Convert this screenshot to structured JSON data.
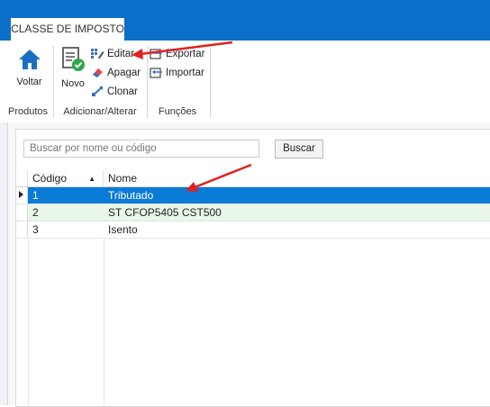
{
  "tab": {
    "label": "CLASSE DE IMPOSTO"
  },
  "ribbon": {
    "produtos": {
      "voltar_label": "Voltar",
      "group_label": "Produtos"
    },
    "adicionar": {
      "novo_label": "Novo",
      "editar_label": "Editar",
      "apagar_label": "Apagar",
      "clonar_label": "Clonar",
      "group_label": "Adicionar/Alterar"
    },
    "funcoes": {
      "exportar_label": "Exportar",
      "importar_label": "Importar",
      "group_label": "Funções"
    }
  },
  "search": {
    "placeholder": "Buscar por nome ou código",
    "button_label": "Buscar"
  },
  "table": {
    "columns": [
      "Código",
      "Nome"
    ],
    "rows": [
      {
        "codigo": "1",
        "nome": "Tributado",
        "selected": true
      },
      {
        "codigo": "2",
        "nome": "ST CFOP5405 CST500"
      },
      {
        "codigo": "3",
        "nome": "Isento"
      }
    ]
  },
  "colors": {
    "accent": "#0a6fc8",
    "selected_row": "#0a7bd6",
    "alt_row": "#e8f7e8",
    "annotation": "#e02020"
  }
}
